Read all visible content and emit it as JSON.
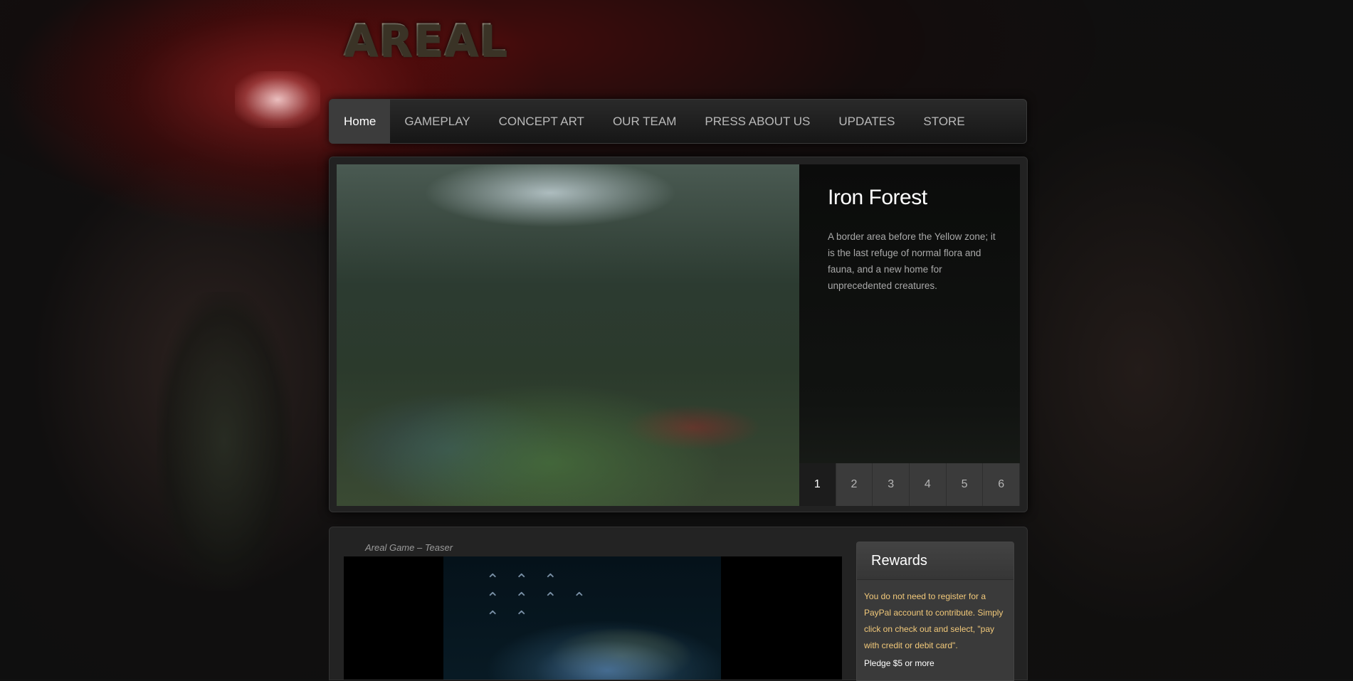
{
  "site": {
    "logo": "AREAL"
  },
  "nav": {
    "items": [
      {
        "label": "Home",
        "active": true
      },
      {
        "label": "GAMEPLAY"
      },
      {
        "label": "CONCEPT ART"
      },
      {
        "label": "OUR TEAM"
      },
      {
        "label": "PRESS ABOUT US"
      },
      {
        "label": "UPDATES"
      },
      {
        "label": "STORE"
      }
    ]
  },
  "slider": {
    "title": "Iron Forest",
    "description": "A border area before the Yellow zone; it is the last refuge of normal flora and fauna, and a new home for unprecedented creatures.",
    "pages": [
      "1",
      "2",
      "3",
      "4",
      "5",
      "6"
    ],
    "active_page": "1"
  },
  "video": {
    "title": "Areal Game – Teaser"
  },
  "rewards": {
    "heading": "Rewards",
    "note": "You do not need to register for a PayPal account to contribute. Simply click on check out and select, \"pay with credit or debit card\".",
    "pledge": "Pledge $5 or more"
  }
}
